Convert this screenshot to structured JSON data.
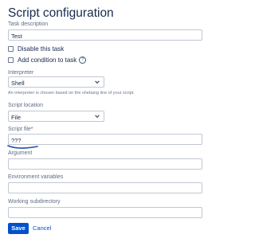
{
  "page": {
    "title": "Script configuration"
  },
  "task_description": {
    "label": "Task description",
    "value": "Test"
  },
  "disable_task": {
    "label": "Disable this task"
  },
  "add_condition": {
    "label": "Add condition to task",
    "help_icon": "?"
  },
  "interpreter": {
    "label": "Interpreter",
    "value": "Shell",
    "hint": "An interpreter is chosen based on the shebang line of your script."
  },
  "script_location": {
    "label": "Script location",
    "value": "File"
  },
  "script_file": {
    "label": "Script file",
    "required_mark": "*",
    "value": "???"
  },
  "argument": {
    "label": "Argument",
    "value": ""
  },
  "environment_variables": {
    "label": "Environment variables",
    "value": ""
  },
  "working_subdirectory": {
    "label": "Working subdirectory",
    "value": ""
  },
  "actions": {
    "save_label": "Save",
    "cancel_label": "Cancel"
  },
  "colors": {
    "primary": "#0052cc",
    "text": "#172b4d",
    "required": "#de350b",
    "annotation": "#1a4fb5"
  }
}
